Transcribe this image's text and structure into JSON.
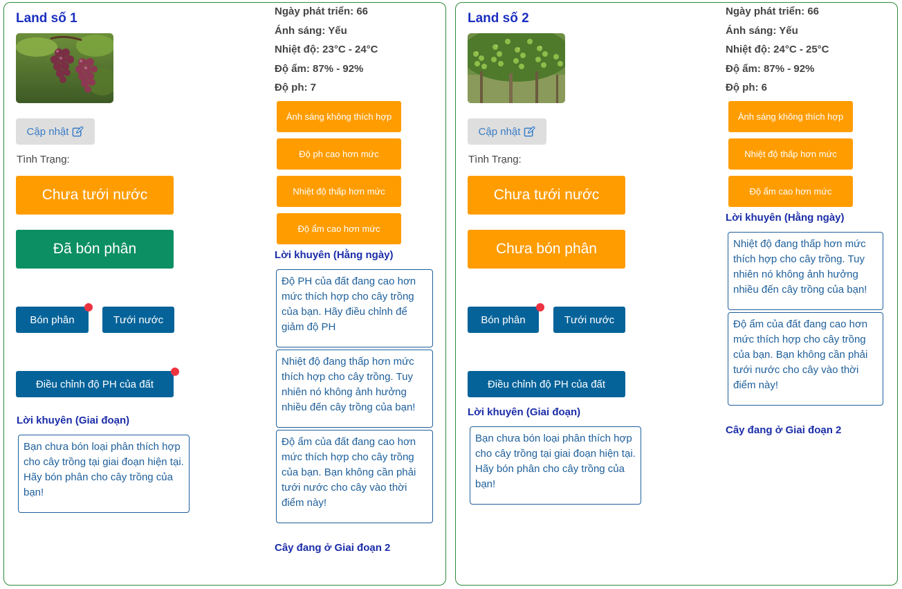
{
  "lands": [
    {
      "title": "Land số 1",
      "update_label": "Cập nhật",
      "status_label": "Tình Trạng:",
      "watering_status": "Chưa tưới nước",
      "fertilizer_status": "Đã bón phân",
      "fertilize_button": "Bón phân",
      "water_button": "Tưới nước",
      "adjust_ph_button": "Điều chỉnh độ PH của đất",
      "stage_advice_title": "Lời khuyên (Giai đoạn)",
      "stage_advice": "Bạn chưa bón loại phân thích hợp cho cây trồng tại giai đoạn hiện tại. Hãy bón phân cho cây trồng của bạn!",
      "info": [
        "Ngày phát triển: 66",
        "Ánh sáng: Yếu",
        "Nhiệt độ: 23°C - 24°C",
        "Độ ẩm: 87% - 92%",
        "Độ ph: 7"
      ],
      "warnings": [
        "Ánh sáng không thích hợp",
        "Độ ph cao hơn mức",
        "Nhiệt độ thấp hơn mức",
        "Độ ẩm cao hơn mức"
      ],
      "daily_advice_title": "Lời khuyên (Hằng ngày)",
      "daily_advice": [
        "Độ PH của đất đang cao hơn mức thích hợp cho cây trồng của bạn. Hãy điều chỉnh để giảm độ PH",
        "Nhiệt độ đang thấp hơn mức thích hợp cho cây trồng. Tuy nhiên nó không ảnh hưởng nhiều đến cây trồng của bạn!",
        "Độ ẩm của đất đang cao hơn mức thích hợp cho cây trồng của bạn. Bạn không cần phải tưới nước cho cây vào thời điểm này!"
      ],
      "stage_text": "Cây đang ở Giai đoạn 2"
    },
    {
      "title": "Land số 2",
      "update_label": "Cập nhật",
      "status_label": "Tình Trạng:",
      "watering_status": "Chưa tưới nước",
      "fertilizer_status": "Chưa bón phân",
      "fertilize_button": "Bón phân",
      "water_button": "Tưới nước",
      "adjust_ph_button": "Điều chỉnh độ PH của đất",
      "stage_advice_title": "Lời khuyên (Giai đoạn)",
      "stage_advice": "Bạn chưa bón loại phân thích hợp cho cây trồng tại giai đoạn hiện tại. Hãy bón phân cho cây trồng của bạn!",
      "info": [
        "Ngày phát triển: 66",
        "Ánh sáng: Yếu",
        "Nhiệt độ: 24°C - 25°C",
        "Độ ẩm: 87% - 92%",
        "Độ ph: 6"
      ],
      "warnings": [
        "Ánh sáng không thích hợp",
        "Nhiệt độ thấp hơn mức",
        "Độ ẩm cao hơn mức"
      ],
      "daily_advice_title": "Lời khuyên (Hằng ngày)",
      "daily_advice": [
        "Nhiệt độ đang thấp hơn mức thích hợp cho cây trồng. Tuy nhiên nó không ảnh hưởng nhiều đến cây trồng của bạn!",
        "Độ ẩm của đất đang cao hơn mức thích hợp cho cây trồng của bạn. Bạn không cần phải tưới nước cho cây vào thời điểm này!"
      ],
      "stage_text": "Cây đang ở Giai đoạn 2"
    }
  ],
  "colors": {
    "orange": "#ff9c00",
    "green": "#0b8f63",
    "blue_button": "#05639a",
    "title_blue": "#1a2fbf",
    "card_border": "#2e8b3a",
    "notification_dot": "#ee3340"
  },
  "icons": [
    "edit-icon",
    "notification-dot"
  ]
}
